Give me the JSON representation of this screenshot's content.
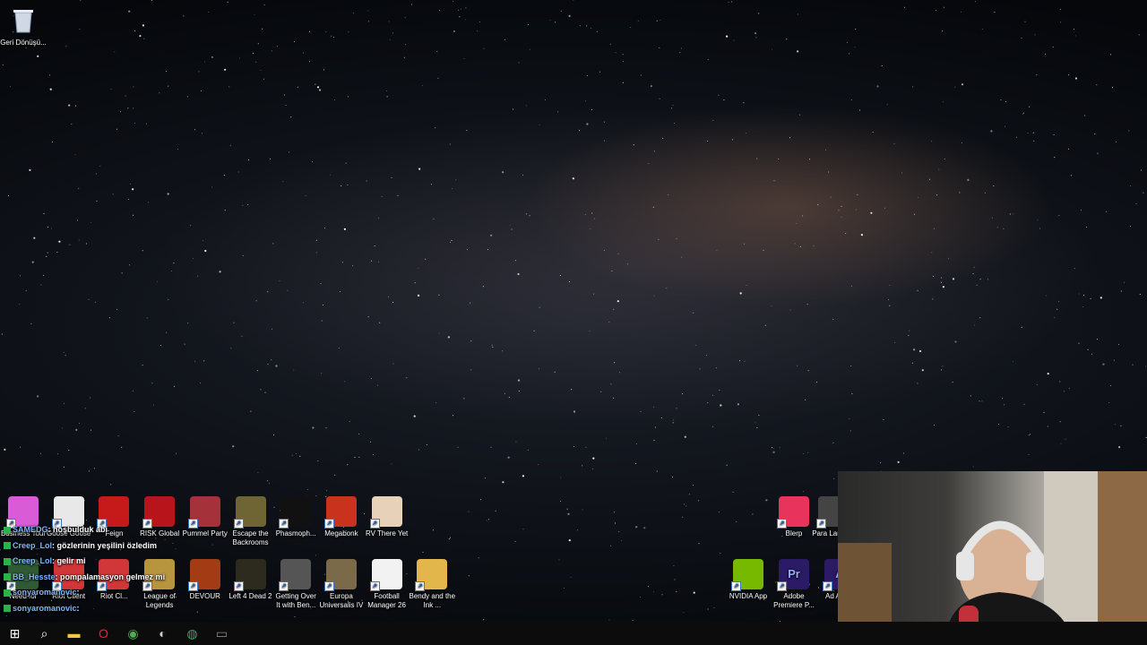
{
  "desktop": {
    "top_icons": [
      {
        "label": "Geri Dönüşü...",
        "icon": "recycle-bin-icon"
      }
    ],
    "row1_icons": [
      {
        "label": "Business Tour",
        "icon": "game-icon",
        "color": "#d95bd6"
      },
      {
        "label": "Goose Goose",
        "icon": "goose-icon",
        "color": "#e8e8e8"
      },
      {
        "label": "Feign",
        "icon": "game-icon",
        "color": "#c61a1a"
      },
      {
        "label": "RISK Global",
        "icon": "risk-icon",
        "color": "#b8141b"
      },
      {
        "label": "Pummel Party",
        "icon": "game-icon",
        "color": "#a5313b"
      },
      {
        "label": "Escape the Backrooms",
        "icon": "game-icon",
        "color": "#6f6433"
      },
      {
        "label": "Phasmoph...",
        "icon": "ghost-icon",
        "color": "#111111"
      },
      {
        "label": "Megabonk",
        "icon": "game-icon",
        "color": "#c9321c"
      },
      {
        "label": "RV There Yet",
        "icon": "game-icon",
        "color": "#e7d1b8"
      }
    ],
    "row2_icons": [
      {
        "label": "Need for",
        "icon": "game-icon",
        "color": "#2f5a33"
      },
      {
        "label": "Riot Client",
        "icon": "riot-icon",
        "color": "#d13639"
      },
      {
        "label": "Riot Cl...",
        "icon": "riot-icon",
        "color": "#d13639"
      },
      {
        "label": "League of Legends",
        "icon": "league-icon",
        "color": "#b7953f"
      },
      {
        "label": "DEVOUR",
        "icon": "game-icon",
        "color": "#a33c14"
      },
      {
        "label": "Left 4 Dead 2",
        "icon": "game-icon",
        "color": "#2d2a1e"
      },
      {
        "label": "Getting Over It with Ben...",
        "icon": "hammer-icon",
        "color": "#555555"
      },
      {
        "label": "Europa Universalis IV",
        "icon": "game-icon",
        "color": "#7a6a4a"
      },
      {
        "label": "Football Manager 26",
        "icon": "game-icon",
        "color": "#f2f2f2"
      },
      {
        "label": "Bendy and the Ink ...",
        "icon": "game-icon",
        "color": "#e3b64b"
      }
    ],
    "right_icons_row1": [
      {
        "label": "Blerp",
        "icon": "star-icon",
        "color": "#e8335c"
      },
      {
        "label": "Para Launc...",
        "icon": "game-icon",
        "color": "#444444"
      }
    ],
    "right_icons_row2": [
      {
        "label": "NVIDIA App",
        "icon": "nvidia-icon",
        "color": "#76b900"
      },
      {
        "label": "Adobe Premiere P...",
        "icon": "premiere-icon",
        "color": "#2b1a66",
        "text": "Pr"
      },
      {
        "label": "Ad Auc...",
        "icon": "audition-icon",
        "color": "#2b1a66",
        "text": "A"
      }
    ]
  },
  "chat": [
    {
      "user": "SAMEDG",
      "message": ": hoşbulduk abi"
    },
    {
      "user": "Creep_Lol",
      "message": ": gözlerinin yeşilini özledim"
    },
    {
      "user": "Creep_Lol",
      "message": ": gelir mi"
    },
    {
      "user": "BB_Hesste",
      "message": ": pompalamasyon gelmez mi"
    },
    {
      "user": "sonyaromanovic",
      "message": ":"
    },
    {
      "user": "sonyaromanovic",
      "message": ":"
    }
  ],
  "taskbar": {
    "items": [
      {
        "icon": "windows-start-icon",
        "glyph": "⊞"
      },
      {
        "icon": "search-icon",
        "glyph": "⌕"
      },
      {
        "icon": "file-explorer-icon",
        "glyph": "▬"
      },
      {
        "icon": "opera-icon",
        "glyph": "O"
      },
      {
        "icon": "chrome-icon",
        "glyph": "◉"
      },
      {
        "icon": "obs-icon",
        "glyph": "◐"
      },
      {
        "icon": "spotify-icon",
        "glyph": "◍"
      },
      {
        "icon": "app-icon",
        "glyph": "▭"
      }
    ]
  },
  "colors": {
    "taskbar": "#0c0c0c",
    "chat_user": "#7fb4ff"
  }
}
